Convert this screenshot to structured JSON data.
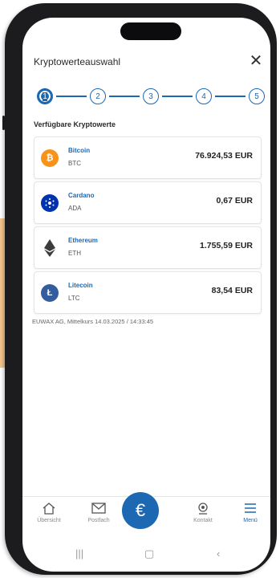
{
  "header": {
    "title": "Kryptowerteauswahl",
    "close_symbol": "✕"
  },
  "stepper": {
    "steps": [
      "1",
      "2",
      "3",
      "4",
      "5"
    ],
    "active": 1
  },
  "section_title": "Verfügbare Kryptowerte",
  "coins": [
    {
      "name": "Bitcoin",
      "ticker": "BTC",
      "price": "76.924,53 EUR",
      "icon": "bitcoin-icon",
      "color": "#f7931a"
    },
    {
      "name": "Cardano",
      "ticker": "ADA",
      "price": "0,67 EUR",
      "icon": "cardano-icon",
      "color": "#0033ad"
    },
    {
      "name": "Ethereum",
      "ticker": "ETH",
      "price": "1.755,59 EUR",
      "icon": "ethereum-icon",
      "color": "#3c3c3d"
    },
    {
      "name": "Litecoin",
      "ticker": "LTC",
      "price": "83,54 EUR",
      "icon": "litecoin-icon",
      "color": "#345d9d"
    }
  ],
  "source_note": "EUWAX AG, Mittelkurs 14.03.2025 / 14:33:45",
  "bottom_nav": {
    "overview": "Übersicht",
    "mailbox": "Postfach",
    "contact": "Kontakt",
    "menu": "Menü",
    "fab_symbol": "€"
  },
  "colors": {
    "accent": "#1d68b3",
    "frame": "#1c1c1e",
    "highlight": "#f5c48a"
  }
}
